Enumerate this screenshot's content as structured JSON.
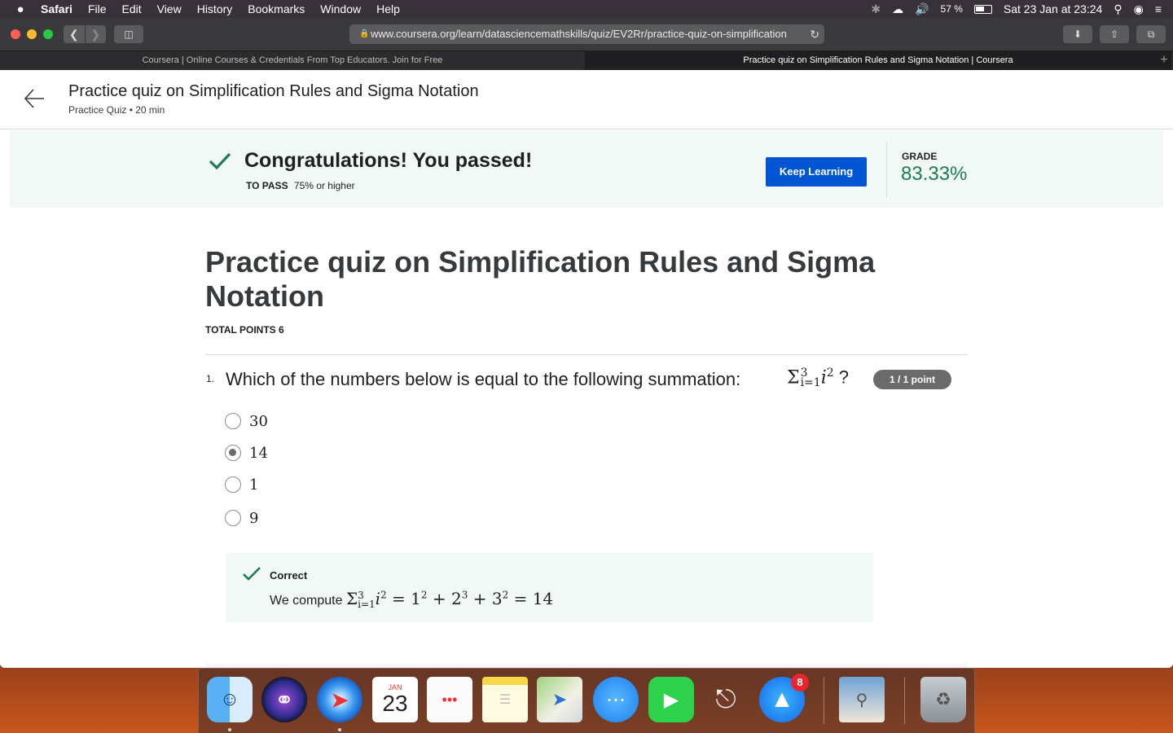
{
  "menubar": {
    "apple": "",
    "app": "Safari",
    "items": [
      "File",
      "Edit",
      "View",
      "History",
      "Bookmarks",
      "Window",
      "Help"
    ],
    "battery": "57 %",
    "datetime": "Sat 23 Jan at  23:24"
  },
  "browser": {
    "url": "www.coursera.org/learn/datasciencemathskills/quiz/EV2Rr/practice-quiz-on-simplification",
    "tabs": [
      {
        "label": "Coursera | Online Courses & Credentials From Top Educators. Join for Free"
      },
      {
        "label": "Practice quiz on Simplification Rules and Sigma Notation | Coursera"
      }
    ]
  },
  "header": {
    "title": "Practice quiz on Simplification Rules and Sigma Notation",
    "subtitle": "Practice Quiz • 20 min"
  },
  "banner": {
    "message": "Congratulations! You passed!",
    "to_pass_label": "TO PASS",
    "to_pass_value": "75% or higher",
    "keep_learning": "Keep Learning",
    "grade_label": "GRADE",
    "grade_value": "83.33%"
  },
  "quiz": {
    "title": "Practice quiz on Simplification Rules and Sigma Notation",
    "total_points": "TOTAL POINTS 6",
    "question": {
      "number": "1.",
      "text": "Which of the numbers below is equal to the following summation:",
      "math_sigma": "Σ",
      "math_upper": "3",
      "math_lower": "i=1",
      "math_term": "i",
      "math_exp": "2",
      "math_q": " ?",
      "points": "1 / 1 point",
      "options": [
        {
          "label": "30",
          "selected": false
        },
        {
          "label": "14",
          "selected": true
        },
        {
          "label": "1",
          "selected": false
        },
        {
          "label": "9",
          "selected": false
        }
      ],
      "feedback_label": "Correct",
      "feedback_prefix": "We compute"
    }
  },
  "dock": {
    "calendar_month": "JAN",
    "calendar_day": "23",
    "appstore_badge": "8"
  }
}
